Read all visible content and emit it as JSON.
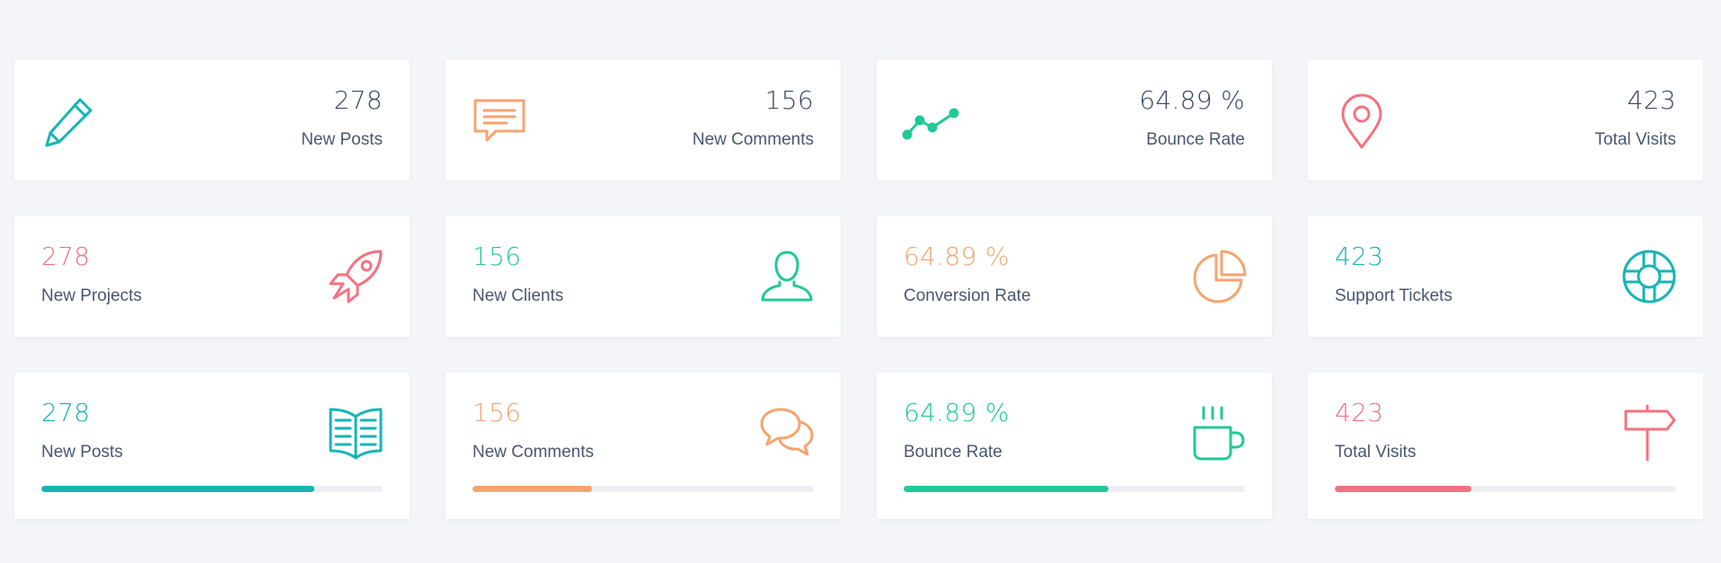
{
  "colors": {
    "teal": "#16b5b5",
    "orange": "#f6a46f",
    "green": "#20c997",
    "pink": "#f3727f",
    "text": "#3b4863",
    "track": "#eceef1"
  },
  "row1": [
    {
      "value": "278",
      "label": "New Posts",
      "icon": "pencil-icon",
      "color": "teal"
    },
    {
      "value": "156",
      "label": "New Comments",
      "icon": "comment-icon",
      "color": "orange"
    },
    {
      "value": "64.89 %",
      "label": "Bounce Rate",
      "icon": "trend-line-icon",
      "color": "green"
    },
    {
      "value": "423",
      "label": "Total Visits",
      "icon": "map-pin-icon",
      "color": "pink"
    }
  ],
  "row2": [
    {
      "value": "278",
      "label": "New Projects",
      "icon": "rocket-icon",
      "color": "pink"
    },
    {
      "value": "156",
      "label": "New Clients",
      "icon": "user-icon",
      "color": "green"
    },
    {
      "value": "64.89 %",
      "label": "Conversion Rate",
      "icon": "pie-chart-icon",
      "color": "orange"
    },
    {
      "value": "423",
      "label": "Support Tickets",
      "icon": "life-ring-icon",
      "color": "teal"
    }
  ],
  "row3": [
    {
      "value": "278",
      "label": "New Posts",
      "icon": "open-book-icon",
      "color": "teal",
      "progress": 0.8
    },
    {
      "value": "156",
      "label": "New Comments",
      "icon": "chat-bubbles-icon",
      "color": "orange",
      "progress": 0.35
    },
    {
      "value": "64.89 %",
      "label": "Bounce Rate",
      "icon": "coffee-mug-icon",
      "color": "green",
      "progress": 0.6
    },
    {
      "value": "423",
      "label": "Total Visits",
      "icon": "signpost-icon",
      "color": "pink",
      "progress": 0.4
    }
  ]
}
